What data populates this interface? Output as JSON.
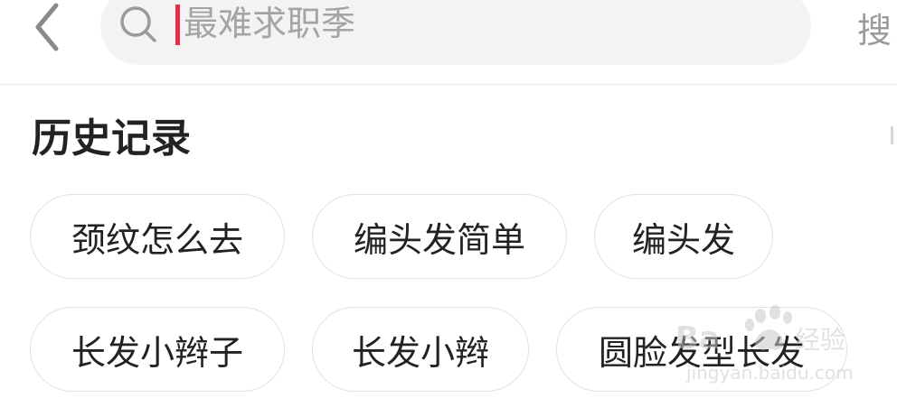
{
  "header": {
    "back_icon": "chevron-left-icon",
    "search": {
      "icon": "search-icon",
      "placeholder": "最难求职季",
      "value": ""
    },
    "search_button_label": "搜"
  },
  "history": {
    "title": "历史记录",
    "items": [
      {
        "label": "颈纹怎么去"
      },
      {
        "label": "编头发简单"
      },
      {
        "label": "编头发"
      },
      {
        "label": "长发小辫子"
      },
      {
        "label": "长发小辫"
      },
      {
        "label": "圆脸发型长发"
      }
    ]
  },
  "watermark": {
    "brand": "Baidu经验",
    "url": "jingyan.baidu.com"
  },
  "colors": {
    "caret": "#ee2a4b",
    "search_bg": "#f3f3f3",
    "chip_border": "#e2e2e2"
  }
}
